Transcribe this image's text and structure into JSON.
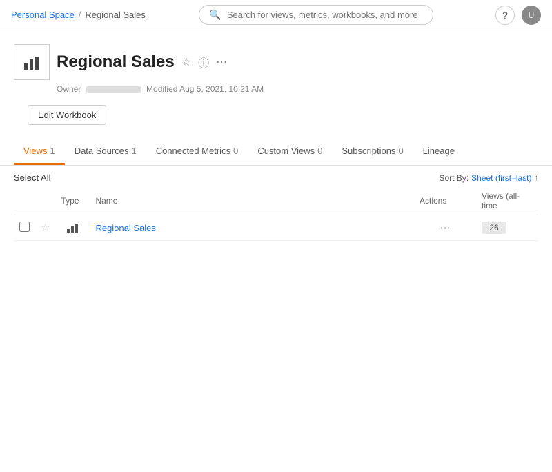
{
  "header": {
    "breadcrumb": {
      "personal_space": "Personal Space",
      "separator": "/",
      "current": "Regional Sales"
    },
    "search_placeholder": "Search for views, metrics, workbooks, and more",
    "help_icon": "?",
    "avatar_initials": "U"
  },
  "workbook": {
    "title": "Regional Sales",
    "owner_label": "Owner",
    "modified_label": "Modified",
    "modified_date": "Aug 5, 2021, 10:21 AM",
    "edit_button": "Edit Workbook"
  },
  "tabs": [
    {
      "id": "views",
      "label": "Views",
      "count": "1",
      "active": true
    },
    {
      "id": "data-sources",
      "label": "Data Sources",
      "count": "1",
      "active": false
    },
    {
      "id": "connected-metrics",
      "label": "Connected Metrics",
      "count": "0",
      "active": false
    },
    {
      "id": "custom-views",
      "label": "Custom Views",
      "count": "0",
      "active": false
    },
    {
      "id": "subscriptions",
      "label": "Subscriptions",
      "count": "0",
      "active": false
    },
    {
      "id": "lineage",
      "label": "Lineage",
      "count": "",
      "active": false
    }
  ],
  "table": {
    "select_all_label": "Select All",
    "sort_by_label": "Sort By:",
    "sort_value": "Sheet (first–last)",
    "sort_arrow": "↑",
    "columns": {
      "type": "Type",
      "name": "Name",
      "actions": "Actions",
      "views": "Views (all-time"
    },
    "rows": [
      {
        "id": "regional-sales-row",
        "name": "Regional Sales",
        "views_count": "26"
      }
    ]
  }
}
